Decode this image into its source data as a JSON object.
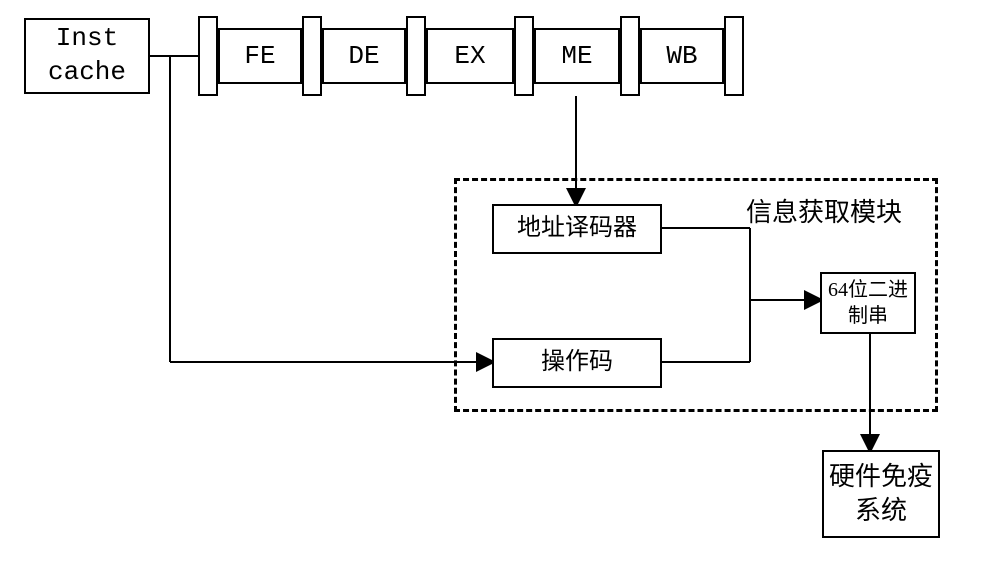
{
  "inst_cache": "Inst\ncache",
  "pipeline": {
    "fe": "FE",
    "de": "DE",
    "ex": "EX",
    "me": "ME",
    "wb": "WB"
  },
  "info_module": {
    "label": "信息获取模块",
    "addr_decoder": "地址译码器",
    "opcode": "操作码",
    "bin64": "64位二进\n制串"
  },
  "hw_immune": "硬件免疫\n系统"
}
